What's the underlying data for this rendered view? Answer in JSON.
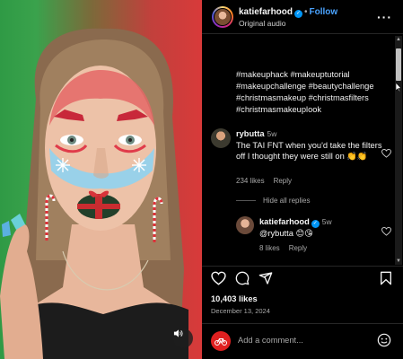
{
  "post": {
    "username": "katiefarhood",
    "follow_label": "Follow",
    "audio_label": "Original audio",
    "separator": "•",
    "caption": "#makeuphack #makeuptutorial #makeupchallenge #beautychallenge #christmasmakeup #christmasfilters #christmasmakeuplook",
    "likes": "10,403 likes",
    "date": "December 13, 2024",
    "add_comment_placeholder": "Add a comment..."
  },
  "comment": {
    "username": "rybutta",
    "time": "5w",
    "text": "The TAI FNT when you'd take the filters off I thought they were still on 👏👏",
    "likes": "234 likes",
    "reply_label": "Reply"
  },
  "hide_replies": "Hide all replies",
  "reply": {
    "username": "katiefarhood",
    "time": "5w",
    "text": "@rybutta 😊😘",
    "likes": "8 likes",
    "reply_label": "Reply"
  },
  "icons": [
    "more-icon",
    "verified-icon",
    "heart-icon",
    "comment-icon",
    "share-icon",
    "bookmark-icon",
    "emoji-icon",
    "audio-icon"
  ],
  "colors": {
    "accent": "#0095f6",
    "background": "#000000",
    "muted": "#a8a8a8"
  }
}
